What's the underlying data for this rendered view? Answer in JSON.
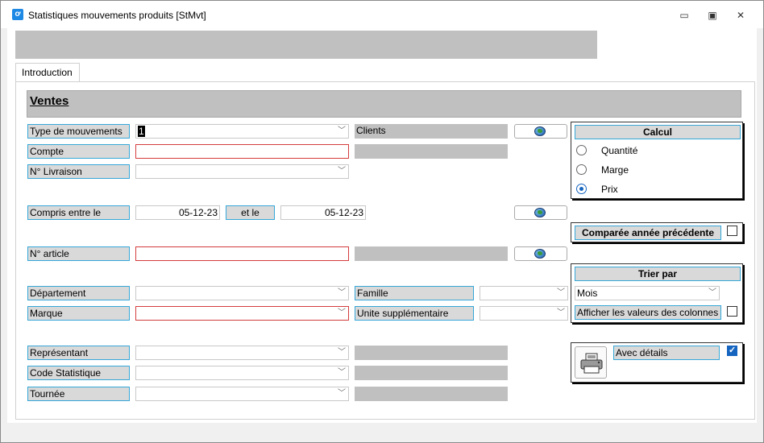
{
  "window": {
    "title": "Statistiques mouvements produits [StMvt]",
    "icon": "app-icon",
    "icon_glyph": "ơ",
    "minimize": "▭",
    "maximize": "▣",
    "close": "✕"
  },
  "tabs": [
    {
      "label": "Introduction",
      "active": true
    }
  ],
  "section": {
    "title": "Ventes"
  },
  "form": {
    "type_mouvements": {
      "label": "Type de mouvements",
      "value": "1"
    },
    "clients": {
      "label": "Clients"
    },
    "compte": {
      "label": "Compte",
      "value": ""
    },
    "livraison": {
      "label": "N° Livraison",
      "value": ""
    },
    "compris_entre": {
      "label": "Compris entre le",
      "from": "05-12-23",
      "and_label": "et le",
      "to": "05-12-23"
    },
    "article": {
      "label": "N° article",
      "value": ""
    },
    "departement": {
      "label": "Département",
      "value": ""
    },
    "famille": {
      "label": "Famille",
      "value": ""
    },
    "marque": {
      "label": "Marque",
      "value": ""
    },
    "unite_supp": {
      "label": "Unite supplémentaire",
      "value": ""
    },
    "representant": {
      "label": "Représentant",
      "value": ""
    },
    "code_statistique": {
      "label": "Code Statistique",
      "value": ""
    },
    "tournee": {
      "label": "Tournée",
      "value": ""
    }
  },
  "calcul": {
    "title": "Calcul",
    "options": [
      {
        "label": "Quantité",
        "checked": false
      },
      {
        "label": "Marge",
        "checked": false
      },
      {
        "label": "Prix",
        "checked": true
      }
    ]
  },
  "comparee": {
    "label": "Comparée année précédente",
    "checked": false
  },
  "trier": {
    "title": "Trier par",
    "value": "Mois",
    "afficher_label": "Afficher les valeurs des colonnes",
    "afficher_checked": false
  },
  "details": {
    "label": "Avec détails",
    "checked": true,
    "print_icon": "printer-icon"
  },
  "colors": {
    "accent": "#35a7d8",
    "required": "#d43c3c",
    "checked": "#1565c0"
  }
}
